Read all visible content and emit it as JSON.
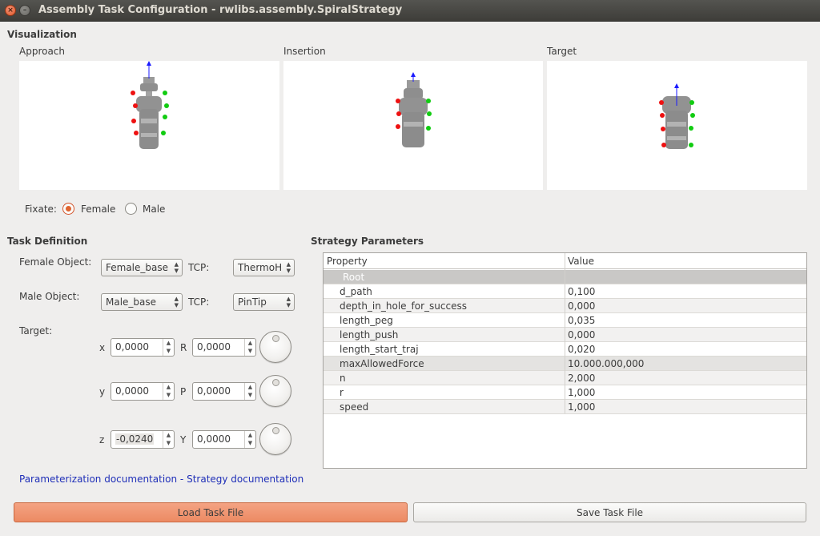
{
  "window": {
    "title": "Assembly Task Configuration - rwlibs.assembly.SpiralStrategy",
    "close_glyph": "×",
    "minimize_glyph": "–"
  },
  "visualization": {
    "heading": "Visualization",
    "views": [
      {
        "label": "Approach"
      },
      {
        "label": "Insertion"
      },
      {
        "label": "Target"
      }
    ],
    "fixate_label": "Fixate:",
    "fixate_options": [
      "Female",
      "Male"
    ],
    "fixate_selected": "Female"
  },
  "task_definition": {
    "heading": "Task Definition",
    "female_object_label": "Female Object:",
    "female_object_value": "Female_base",
    "male_object_label": "Male Object:",
    "male_object_value": "Male_base",
    "tcp_label": "TCP:",
    "female_tcp_value": "ThermoH",
    "male_tcp_value": "PinTip",
    "target_label": "Target:",
    "target": [
      {
        "pos_label": "x",
        "pos_value": "0,0000",
        "rot_label": "R",
        "rot_value": "0,0000"
      },
      {
        "pos_label": "y",
        "pos_value": "0,0000",
        "rot_label": "P",
        "rot_value": "0,0000"
      },
      {
        "pos_label": "z",
        "pos_value": "-0,0240",
        "rot_label": "Y",
        "rot_value": "0,0000"
      }
    ],
    "doc_link_1": "Parameterization documentation",
    "doc_separator": " - ",
    "doc_link_2": "Strategy documentation"
  },
  "strategy_parameters": {
    "heading": "Strategy Parameters",
    "columns": [
      "Property",
      "Value"
    ],
    "root_label": "Root",
    "rows": [
      {
        "property": "d_path",
        "value": "0,100"
      },
      {
        "property": "depth_in_hole_for_success",
        "value": "0,000"
      },
      {
        "property": "length_peg",
        "value": "0,035"
      },
      {
        "property": "length_push",
        "value": "0,000"
      },
      {
        "property": "length_start_traj",
        "value": "0,020"
      },
      {
        "property": "maxAllowedForce",
        "value": "10.000.000,000"
      },
      {
        "property": "n",
        "value": "2,000"
      },
      {
        "property": "r",
        "value": "1,000"
      },
      {
        "property": "speed",
        "value": "1,000"
      }
    ]
  },
  "buttons": {
    "load": "Load Task File",
    "save": "Save Task File"
  },
  "colors": {
    "accent": "#e0642f",
    "link": "#1f2fb8"
  }
}
